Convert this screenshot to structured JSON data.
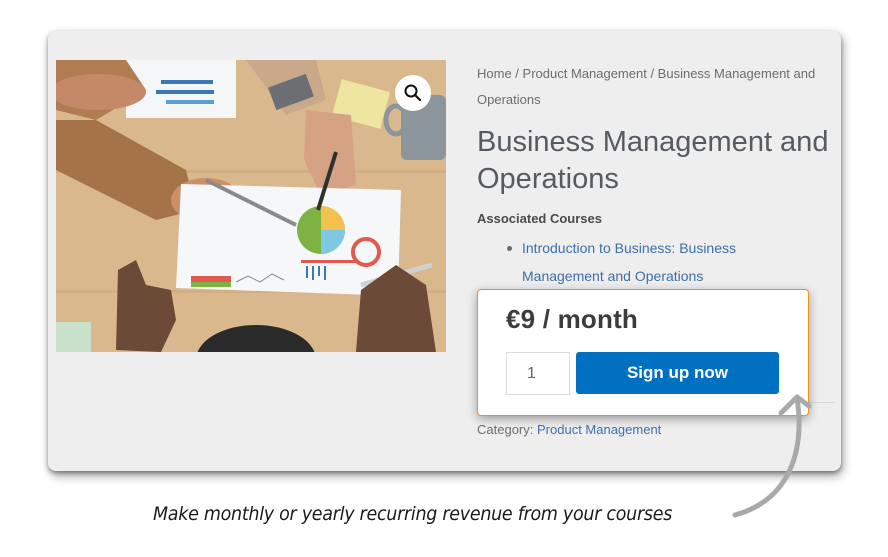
{
  "product_image": {
    "alt": "Team reviewing business charts on a table",
    "zoom_icon": "magnifier-icon"
  },
  "breadcrumb": {
    "items": [
      "Home",
      "Product Management",
      "Business Management and Operations"
    ],
    "separator": " / "
  },
  "product": {
    "title": "Business Management and Operations",
    "associated_label": "Associated Courses",
    "courses": [
      "Introduction to Business: Business Management and Operations"
    ],
    "category_label": "Category:",
    "category": "Product Management"
  },
  "purchase": {
    "price": "€9 / month",
    "quantity": "1",
    "button_label": "Sign up now",
    "accent_border": "#f0901e",
    "button_color": "#0070c0"
  },
  "annotation": {
    "caption": "Make monthly or yearly recurring revenue from your courses",
    "arrow_icon": "curved-arrow-icon"
  }
}
